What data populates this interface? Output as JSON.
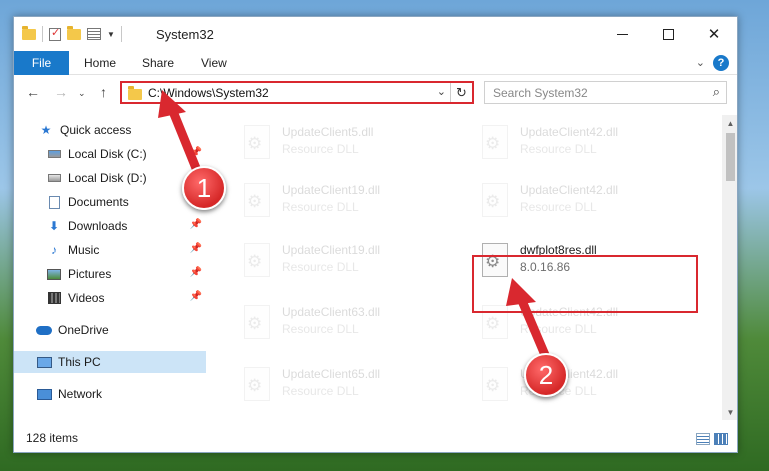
{
  "window": {
    "title": "System32",
    "controls": {
      "minimize": "—",
      "maximize": "",
      "close": "✕"
    }
  },
  "ribbon": {
    "file_tab": "File",
    "tabs": [
      "Home",
      "Share",
      "View"
    ],
    "help": "?"
  },
  "address": {
    "path": "C:\\Windows\\System32",
    "search_placeholder": "Search System32"
  },
  "sidebar": {
    "items": [
      {
        "label": "Quick access",
        "icon": "star-icon",
        "pinned": false
      },
      {
        "label": "Local Disk (C:)",
        "icon": "drive-icon",
        "pinned": true
      },
      {
        "label": "Local Disk (D:)",
        "icon": "drive-icon",
        "pinned": false
      },
      {
        "label": "Documents",
        "icon": "documents-icon",
        "pinned": true
      },
      {
        "label": "Downloads",
        "icon": "download-icon",
        "pinned": true
      },
      {
        "label": "Music",
        "icon": "music-icon",
        "pinned": true
      },
      {
        "label": "Pictures",
        "icon": "pictures-icon",
        "pinned": true
      },
      {
        "label": "Videos",
        "icon": "videos-icon",
        "pinned": true
      },
      {
        "label": "OneDrive",
        "icon": "onedrive-icon",
        "pinned": false
      },
      {
        "label": "This PC",
        "icon": "this-pc-icon",
        "pinned": false,
        "selected": true
      },
      {
        "label": "Network",
        "icon": "network-icon",
        "pinned": false
      }
    ]
  },
  "files": {
    "left_column": [
      {
        "name": "UpdateClient5.dll",
        "type": "Resource DLL"
      },
      {
        "name": "UpdateClient19.dll",
        "type": "Resource DLL"
      },
      {
        "name": "UpdateClient19.dll",
        "type": "Resource DLL"
      },
      {
        "name": "UpdateClient63.dll",
        "type": "Resource DLL"
      },
      {
        "name": "UpdateClient65.dll",
        "type": "Resource DLL"
      }
    ],
    "right_column": [
      {
        "name": "UpdateClient42.dll",
        "type": "Resource DLL"
      },
      {
        "name": "UpdateClient42.dll",
        "type": "Resource DLL"
      },
      {
        "name": "dwfplot8res.dll",
        "type": "8.0.16.86",
        "highlighted": true
      },
      {
        "name": "UpdateClient42.dll",
        "type": "Resource DLL"
      },
      {
        "name": "UpdateClient42.dll",
        "type": "Resource DLL"
      }
    ]
  },
  "status": {
    "item_count": "128 items"
  },
  "annotations": {
    "callout_1": "1",
    "callout_2": "2",
    "color": "#d9282f"
  }
}
